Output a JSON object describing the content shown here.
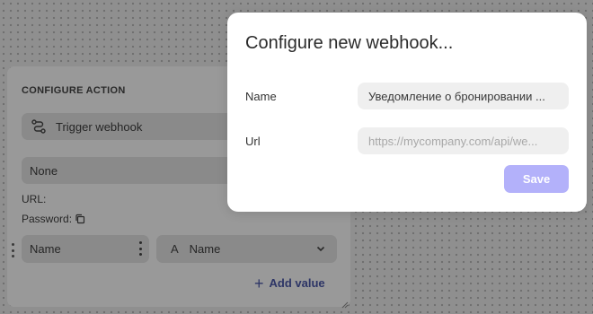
{
  "colors": {
    "overlay_background": "#8f8f8f",
    "modal_background": "#ffffff",
    "input_background": "#efefef",
    "save_button": "#b3b1fa",
    "add_value_text": "#2d3566"
  },
  "configure_action": {
    "title": "CONFIGURE ACTION",
    "trigger": {
      "icon": "route-icon",
      "label": "Trigger webhook"
    },
    "webhook_select_value": "None",
    "url_label": "URL:",
    "password_label": "Password:",
    "password_icon": "copy-icon",
    "value_row": {
      "name_value": "Name",
      "select_icon": "text-type-icon",
      "select_icon_glyph": "A",
      "select_value": "Name"
    },
    "add_value": {
      "icon": "plus-icon",
      "label": "Add value"
    }
  },
  "modal": {
    "title": "Configure new webhook...",
    "name_label": "Name",
    "name_value": "Уведомление о бронировании ...",
    "url_label": "Url",
    "url_placeholder": "https://mycompany.com/api/we...",
    "save_label": "Save"
  }
}
